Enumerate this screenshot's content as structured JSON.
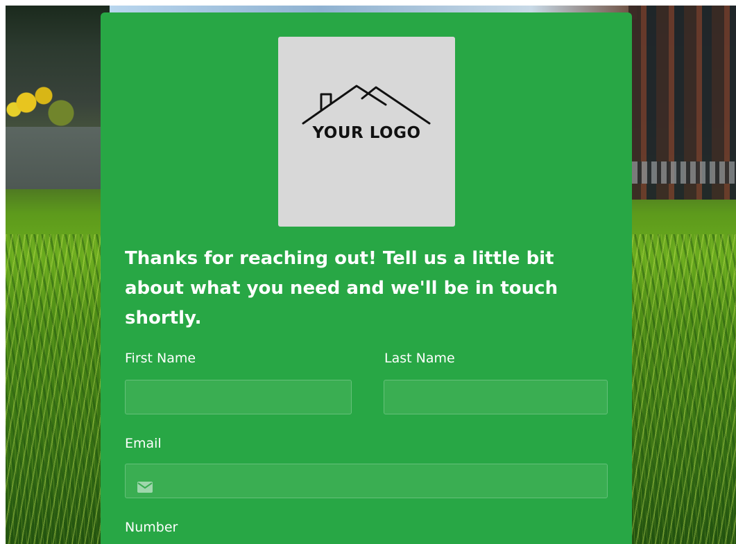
{
  "logo": {
    "text": "YOUR LOGO"
  },
  "form": {
    "heading": "Thanks for reaching out! Tell us a little bit about what you need and we'll be in touch shortly.",
    "fields": {
      "first_name": {
        "label": "First Name",
        "value": ""
      },
      "last_name": {
        "label": "Last Name",
        "value": ""
      },
      "email": {
        "label": "Email",
        "value": "",
        "icon": "envelope-icon"
      },
      "number": {
        "label": "Number"
      }
    }
  },
  "colors": {
    "card_background": "#28a745",
    "input_background": "#3aae52",
    "text": "#ffffff"
  }
}
